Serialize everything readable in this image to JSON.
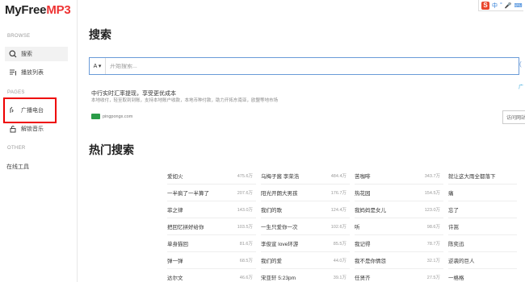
{
  "app": {
    "logo_main": "MyFree",
    "logo_accent": "MP3"
  },
  "sidebar": {
    "sections": {
      "browse": "BROWSE",
      "pages": "PAGES",
      "other": "OTHER"
    },
    "items": [
      {
        "label": "搜索",
        "icon": "search-icon",
        "active": true
      },
      {
        "label": "播放列表",
        "icon": "playlist-icon",
        "active": false
      },
      {
        "label": "广播电台",
        "icon": "radio-icon",
        "active": false
      },
      {
        "label": "解锁音乐",
        "icon": "unlock-icon",
        "active": false
      },
      {
        "label": "在线工具",
        "icon": "",
        "active": false
      }
    ]
  },
  "toolbar": {
    "s_label": "S",
    "items": [
      "中",
      "°",
      "🎤",
      "⌨"
    ]
  },
  "main": {
    "title": "搜索",
    "search": {
      "type_label": "A ▾",
      "placeholder": "开始搜索...",
      "button_glyph": "("
    },
    "ad": {
      "corner": "广",
      "title": "中行实时汇率提现，享受更优成本",
      "desc": "本地收付，轻至取到到账，支持本地账户收款，本地币种付款，助力开拓东南亚，欧盟等地市场",
      "source": "pingpongx.com",
      "button": "访问网站"
    },
    "hot_title": "热门搜索",
    "hot": [
      [
        {
          "name": "爱如火",
          "count": "475.6万"
        },
        {
          "name": "一半疯了一半算了",
          "count": "207.6万"
        },
        {
          "name": "菲之律",
          "count": "143.0万"
        },
        {
          "name": "把回忆拼好给你",
          "count": "103.5万"
        },
        {
          "name": "单身猫回",
          "count": "81.6万"
        },
        {
          "name": "弹一弹",
          "count": "68.5万"
        },
        {
          "name": "达尔文",
          "count": "46.6万"
        }
      ],
      [
        {
          "name": "乌梅子酱 李荣浩",
          "count": "484.4万"
        },
        {
          "name": "阳光开朗大男孩",
          "count": "176.7万"
        },
        {
          "name": "我们的歌",
          "count": "124.4万"
        },
        {
          "name": "一生只爱你一次",
          "count": "102.6万"
        },
        {
          "name": "李俊宣 love环游",
          "count": "85.5万"
        },
        {
          "name": "我们的爱",
          "count": "44.0万"
        },
        {
          "name": "宋亚轩 5:23pm",
          "count": "39.1万"
        }
      ],
      [
        {
          "name": "苦咖啡",
          "count": "343.7万"
        },
        {
          "name": "热花园",
          "count": "154.5万"
        },
        {
          "name": "我妈妈是女儿",
          "count": "123.0万"
        },
        {
          "name": "听",
          "count": "98.6万"
        },
        {
          "name": "我记得",
          "count": "78.7万"
        },
        {
          "name": "我不是你情怨",
          "count": "32.1万"
        },
        {
          "name": "任贤齐",
          "count": "27.5万"
        }
      ],
      [
        {
          "name": "就让这大雨全都落下",
          "count": ""
        },
        {
          "name": "痛",
          "count": ""
        },
        {
          "name": "忘了",
          "count": ""
        },
        {
          "name": "许嵩",
          "count": ""
        },
        {
          "name": "陈奕迅",
          "count": ""
        },
        {
          "name": "逆袭的巨人",
          "count": ""
        },
        {
          "name": "一格格",
          "count": ""
        }
      ]
    ]
  },
  "colors": {
    "accent": "#e33333",
    "highlight_box": "#ee0000",
    "search_border": "#6a9bd8"
  }
}
